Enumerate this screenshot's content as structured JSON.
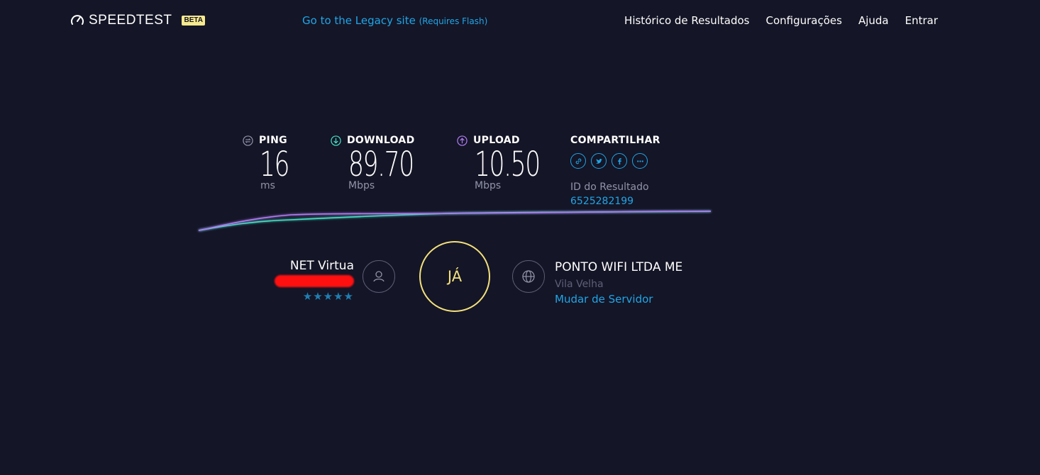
{
  "header": {
    "logo_text": "SPEEDTEST",
    "beta_label": "BETA",
    "legacy_link": "Go to the Legacy site",
    "legacy_note": "(Requires Flash)",
    "nav": [
      "Histórico de Resultados",
      "Configurações",
      "Ajuda",
      "Entrar"
    ]
  },
  "results": {
    "ping": {
      "label": "PING",
      "value": "16",
      "unit": "ms"
    },
    "download": {
      "label": "DOWNLOAD",
      "value": "89.70",
      "unit": "Mbps"
    },
    "upload": {
      "label": "UPLOAD",
      "value": "10.50",
      "unit": "Mbps"
    },
    "share": {
      "title": "COMPARTILHAR",
      "icons": [
        "link-icon",
        "twitter-icon",
        "facebook-icon",
        "more-icon"
      ]
    },
    "result_id_label": "ID do Resultado",
    "result_id": "6525282199"
  },
  "isp": {
    "name": "NET Virtua",
    "stars": "★★★★★",
    "rating": 5
  },
  "go_button": "JÁ",
  "server": {
    "name": "PONTO WIFI LTDA ME",
    "city": "Vila Velha",
    "change_label": "Mudar de Servidor"
  },
  "colors": {
    "background": "#141526",
    "accent_blue": "#1fa6e8",
    "go_yellow": "#f3e07d",
    "download_teal": "#47e0c6",
    "upload_purple": "#b07df2"
  }
}
